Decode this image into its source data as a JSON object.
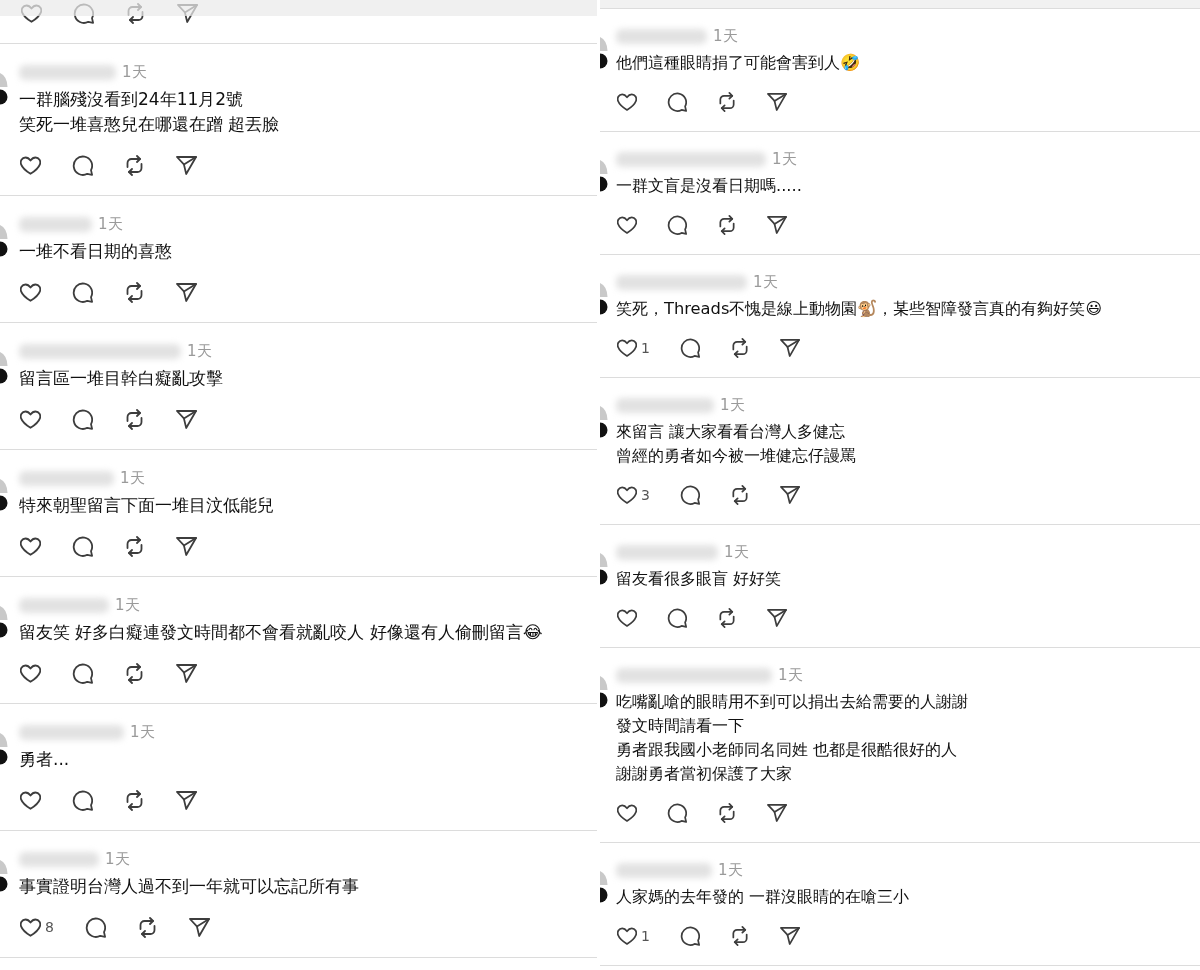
{
  "columns": [
    {
      "comments": [
        {
          "kind": "cut_off"
        },
        {
          "kind": "comment",
          "time": "1天",
          "lines": [
            "一群腦殘沒看到24年11月2號",
            "笑死一堆喜憨兒在哪還在蹭 超丟臉"
          ]
        },
        {
          "kind": "comment",
          "time": "1天",
          "lines": [
            "一堆不看日期的喜憨"
          ]
        },
        {
          "kind": "comment",
          "time": "1天",
          "lines": [
            "留言區一堆目幹白癡亂攻擊"
          ]
        },
        {
          "kind": "comment",
          "time": "1天",
          "lines": [
            "特來朝聖留言下面一堆目汶低能兒"
          ]
        },
        {
          "kind": "comment",
          "time": "1天",
          "lines": [
            "留友笑 好多白癡連發文時間都不會看就亂咬人 好像還有人偷刪留言😂"
          ]
        },
        {
          "kind": "comment",
          "time": "1天",
          "lines": [
            "勇者..."
          ]
        },
        {
          "kind": "comment",
          "time": "1天",
          "lines": [
            "事實證明台灣人過不到一年就可以忘記所有事"
          ],
          "likes": "8"
        }
      ]
    },
    {
      "comments": [
        {
          "kind": "comment",
          "time": "1天",
          "lines": [
            "他們這種眼睛捐了可能會害到人🤣"
          ]
        },
        {
          "kind": "comment",
          "time": "1天",
          "lines": [
            "一群文盲是沒看日期嗎....."
          ]
        },
        {
          "kind": "comment",
          "time": "1天",
          "lines": [
            "笑死，Threads不愧是線上動物園🐒，某些智障發言真的有夠好笑😃"
          ],
          "likes": "1"
        },
        {
          "kind": "comment",
          "time": "1天",
          "lines": [
            "來留言 讓大家看看台灣人多健忘",
            "曾經的勇者如今被一堆健忘仔謾罵"
          ],
          "likes": "3"
        },
        {
          "kind": "comment",
          "time": "1天",
          "lines": [
            "留友看很多眼盲 好好笑"
          ]
        },
        {
          "kind": "comment",
          "time": "1天",
          "lines": [
            "吃嘴亂嗆的眼睛用不到可以捐出去給需要的人謝謝",
            "發文時間請看一下",
            "勇者跟我國小老師同名同姓 也都是很酷很好的人",
            "謝謝勇者當初保護了大家"
          ]
        },
        {
          "kind": "comment",
          "time": "1天",
          "lines": [
            "人家媽的去年發的 一群沒眼睛的在嗆三小"
          ],
          "likes": "1"
        }
      ]
    }
  ]
}
